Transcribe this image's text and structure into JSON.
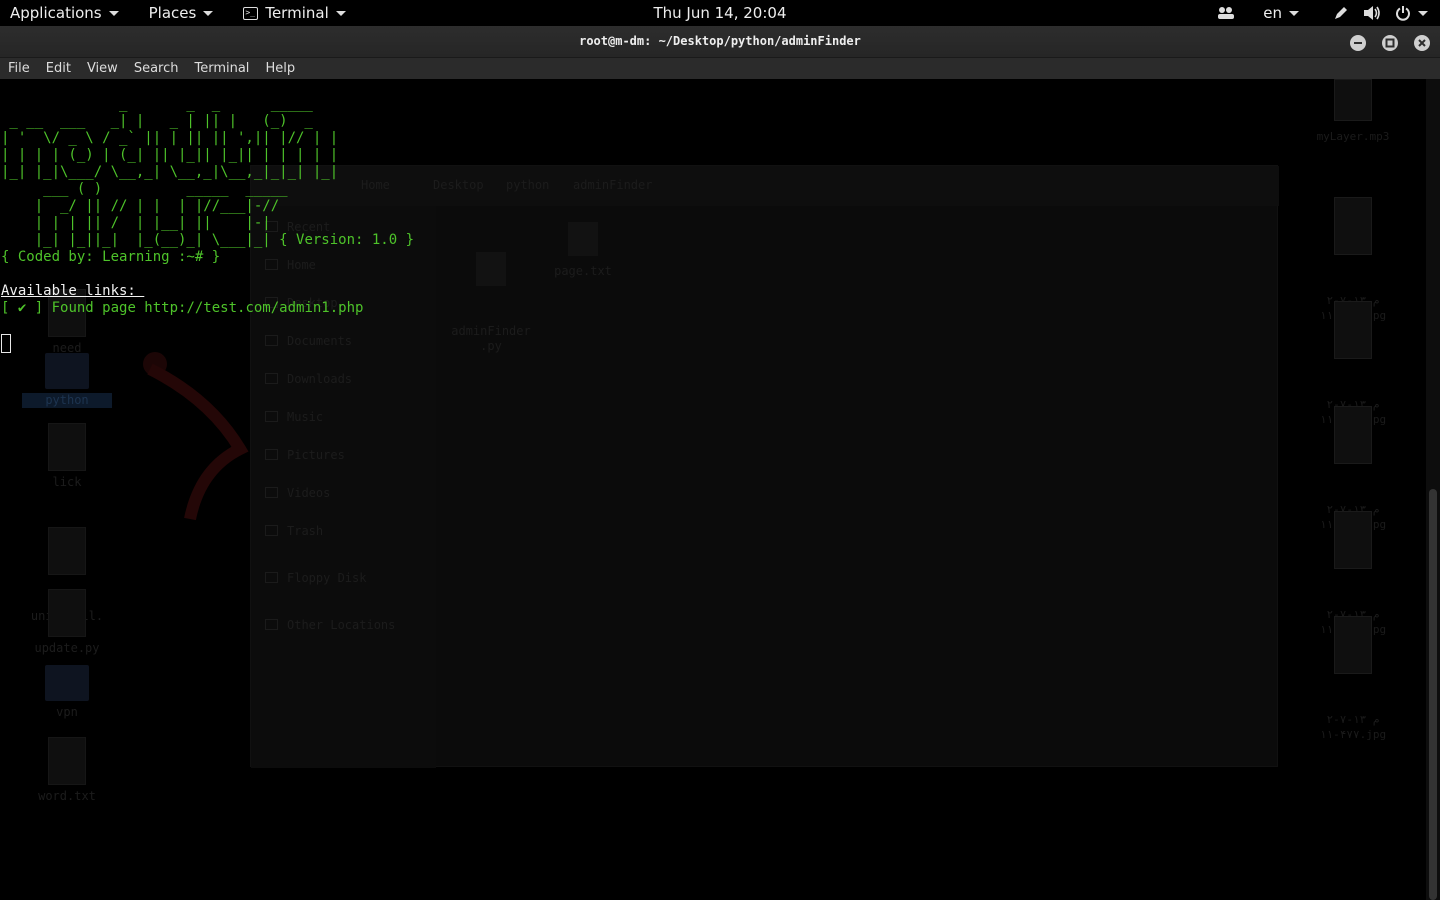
{
  "panel": {
    "applications_label": "Applications",
    "places_label": "Places",
    "terminal_label": "Terminal",
    "clock": "Thu Jun 14, 20:04",
    "language": "en",
    "icons": [
      "people-icon",
      "pen-icon",
      "volume-icon",
      "power-icon"
    ]
  },
  "window": {
    "title": "root@m-dm: ~/Desktop/python/adminFinder"
  },
  "menubar": {
    "file": "File",
    "edit": "Edit",
    "view": "View",
    "search": "Search",
    "terminal": "Terminal",
    "help": "Help"
  },
  "terminal": {
    "banner_lines": [
      "              _       _  _      _____ ",
      " _ __  ___   _| |   _ | || |   (_)  _ ",
      "| '  \\/ _ \\ / _` || | || || ',|| |// | |",
      "| | | | (_) | (_| || |_|| |_|| | | | | |",
      "|_| |_|\\___/ \\__,_| \\__,_|\\__,_|_|_| |_|",
      "     ___ ( )          _____  _____",
      "    |  _/ || // | |  | |//___|-//",
      "    | | | || /  | |__| ||    |-|",
      "    |_| |_||_|  |_(__)_| \\___|_|"
    ],
    "version": "{ Version: 1.0 }",
    "coded_by": "{ Coded by: Learning :~# }",
    "available_links": "Available links: ",
    "found_marker": "[ ✔ ]",
    "found_text": " Found page http://test.com/admin1.php"
  },
  "ghost_desktop": {
    "left_files": [
      "need",
      "python",
      "lick",
      "uninstall.\nsh",
      "update.py",
      "vpn",
      "word.txt"
    ],
    "right_files": [
      "myLayer.mp3",
      "م ۱۳-۷-۲\n۱۱-۴۳۱.jpg",
      "م ۱۳-۷-۲\n۱۱-۴۷۲.jpg",
      "م ۱۳-۷-۲\n۱۱-۵-۰.jpg",
      "م ۱۳-۷-۲\n۱۱-۴۷۳.jpg",
      "م ۱۳-۷-۲\n۱۱-۴۷۷.jpg"
    ],
    "fm_crumbs": [
      "Home",
      "Desktop",
      "python",
      "adminFinder"
    ],
    "fm_sidebar": [
      "Recent",
      "Home",
      "Desktop",
      "Documents",
      "Downloads",
      "Music",
      "Pictures",
      "Videos",
      "Trash",
      "Floppy Disk",
      "Other Locations"
    ],
    "fm_files": [
      "adminFinder\n.py",
      "page.txt"
    ]
  },
  "colors": {
    "terminal_green": "#4ec32a",
    "panel_bg": "#000000",
    "titlebar_bg": "#2d2d2d"
  }
}
